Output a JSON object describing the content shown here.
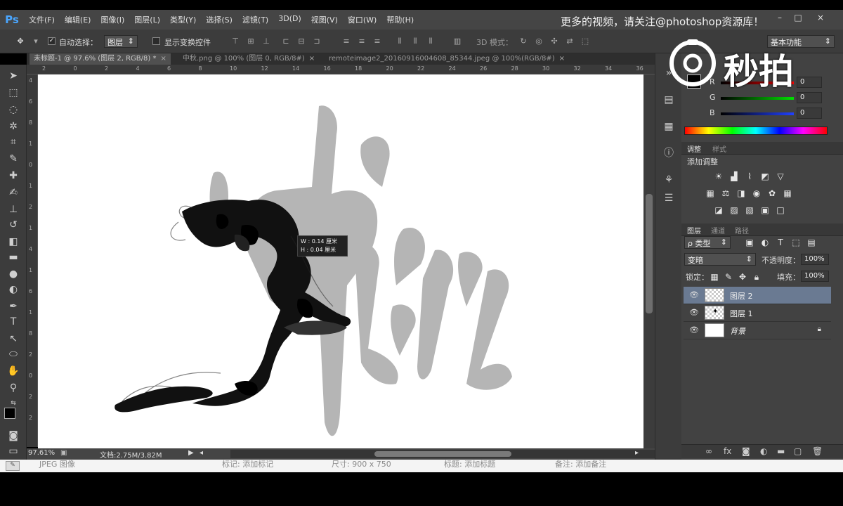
{
  "app": {
    "logo": "Ps"
  },
  "menu": [
    "文件(F)",
    "编辑(E)",
    "图像(I)",
    "图层(L)",
    "类型(Y)",
    "选择(S)",
    "滤镜(T)",
    "3D(D)",
    "视图(V)",
    "窗口(W)",
    "帮助(H)"
  ],
  "watermark_top": "更多的视频，请关注@photoshop资源库！",
  "watermark_logo": "秒拍",
  "options": {
    "auto_select_label": "自动选择：",
    "auto_select_value": "图层",
    "show_transform_label": "显示变换控件",
    "mode3d_label": "3D 模式：",
    "workspace_value": "基本功能"
  },
  "tabs": [
    {
      "label": "未标题-1 @ 97.6% (图层 2, RGB/8) *",
      "close": "×"
    },
    {
      "label": "中秋.png @ 100% (图层 0, RGB/8#)",
      "close": "×"
    },
    {
      "label": "remoteimage2_20160916004608_85344.jpeg @ 100%(RGB/8#)",
      "close": "×"
    }
  ],
  "ruler_top_ticks": [
    "2",
    "0",
    "2",
    "4",
    "6",
    "8",
    "10",
    "12",
    "14",
    "16",
    "18",
    "20",
    "22",
    "24",
    "26",
    "28",
    "30",
    "32",
    "34",
    "36"
  ],
  "ruler_left_ticks": [
    "4",
    "6",
    "8",
    "1",
    "0",
    "1",
    "2",
    "1",
    "4",
    "1",
    "6",
    "1",
    "8",
    "2",
    "0",
    "2",
    "2"
  ],
  "canvas": {
    "background_text": "中秋",
    "tooltip_line1": "W : 0.14 厘米",
    "tooltip_line2": "H : 0.04 厘米"
  },
  "status": {
    "zoom": "97.61%",
    "doc": "文档:2.75M/3.82M"
  },
  "bottom_strip": [
    "JPEG 图像",
    "标记: 添加标记",
    "尺寸: 900 x 750",
    "标题: 添加标题",
    "备注: 添加备注"
  ],
  "color_panel": {
    "channels": [
      {
        "label": "R",
        "value": "0",
        "color": "#ff3030"
      },
      {
        "label": "G",
        "value": "0",
        "color": "#30d030"
      },
      {
        "label": "B",
        "value": "0",
        "color": "#3050ff"
      }
    ]
  },
  "adjust_panel": {
    "tabs": [
      "调整",
      "样式"
    ],
    "title": "添加调整"
  },
  "layers_panel": {
    "tabs": [
      "图层",
      "通道",
      "路径"
    ],
    "filter_label": "ρ 类型",
    "blend_mode": "变暗",
    "opacity_label": "不透明度：",
    "opacity_value": "100%",
    "lock_label": "锁定：",
    "fill_label": "填充：",
    "fill_value": "100%",
    "layers": [
      {
        "name": "图层 2",
        "selected": true,
        "thumb": "checker"
      },
      {
        "name": "图层 1",
        "selected": false,
        "thumb": "checker"
      },
      {
        "name": "背景",
        "selected": false,
        "thumb": "white",
        "locked": true
      }
    ]
  }
}
